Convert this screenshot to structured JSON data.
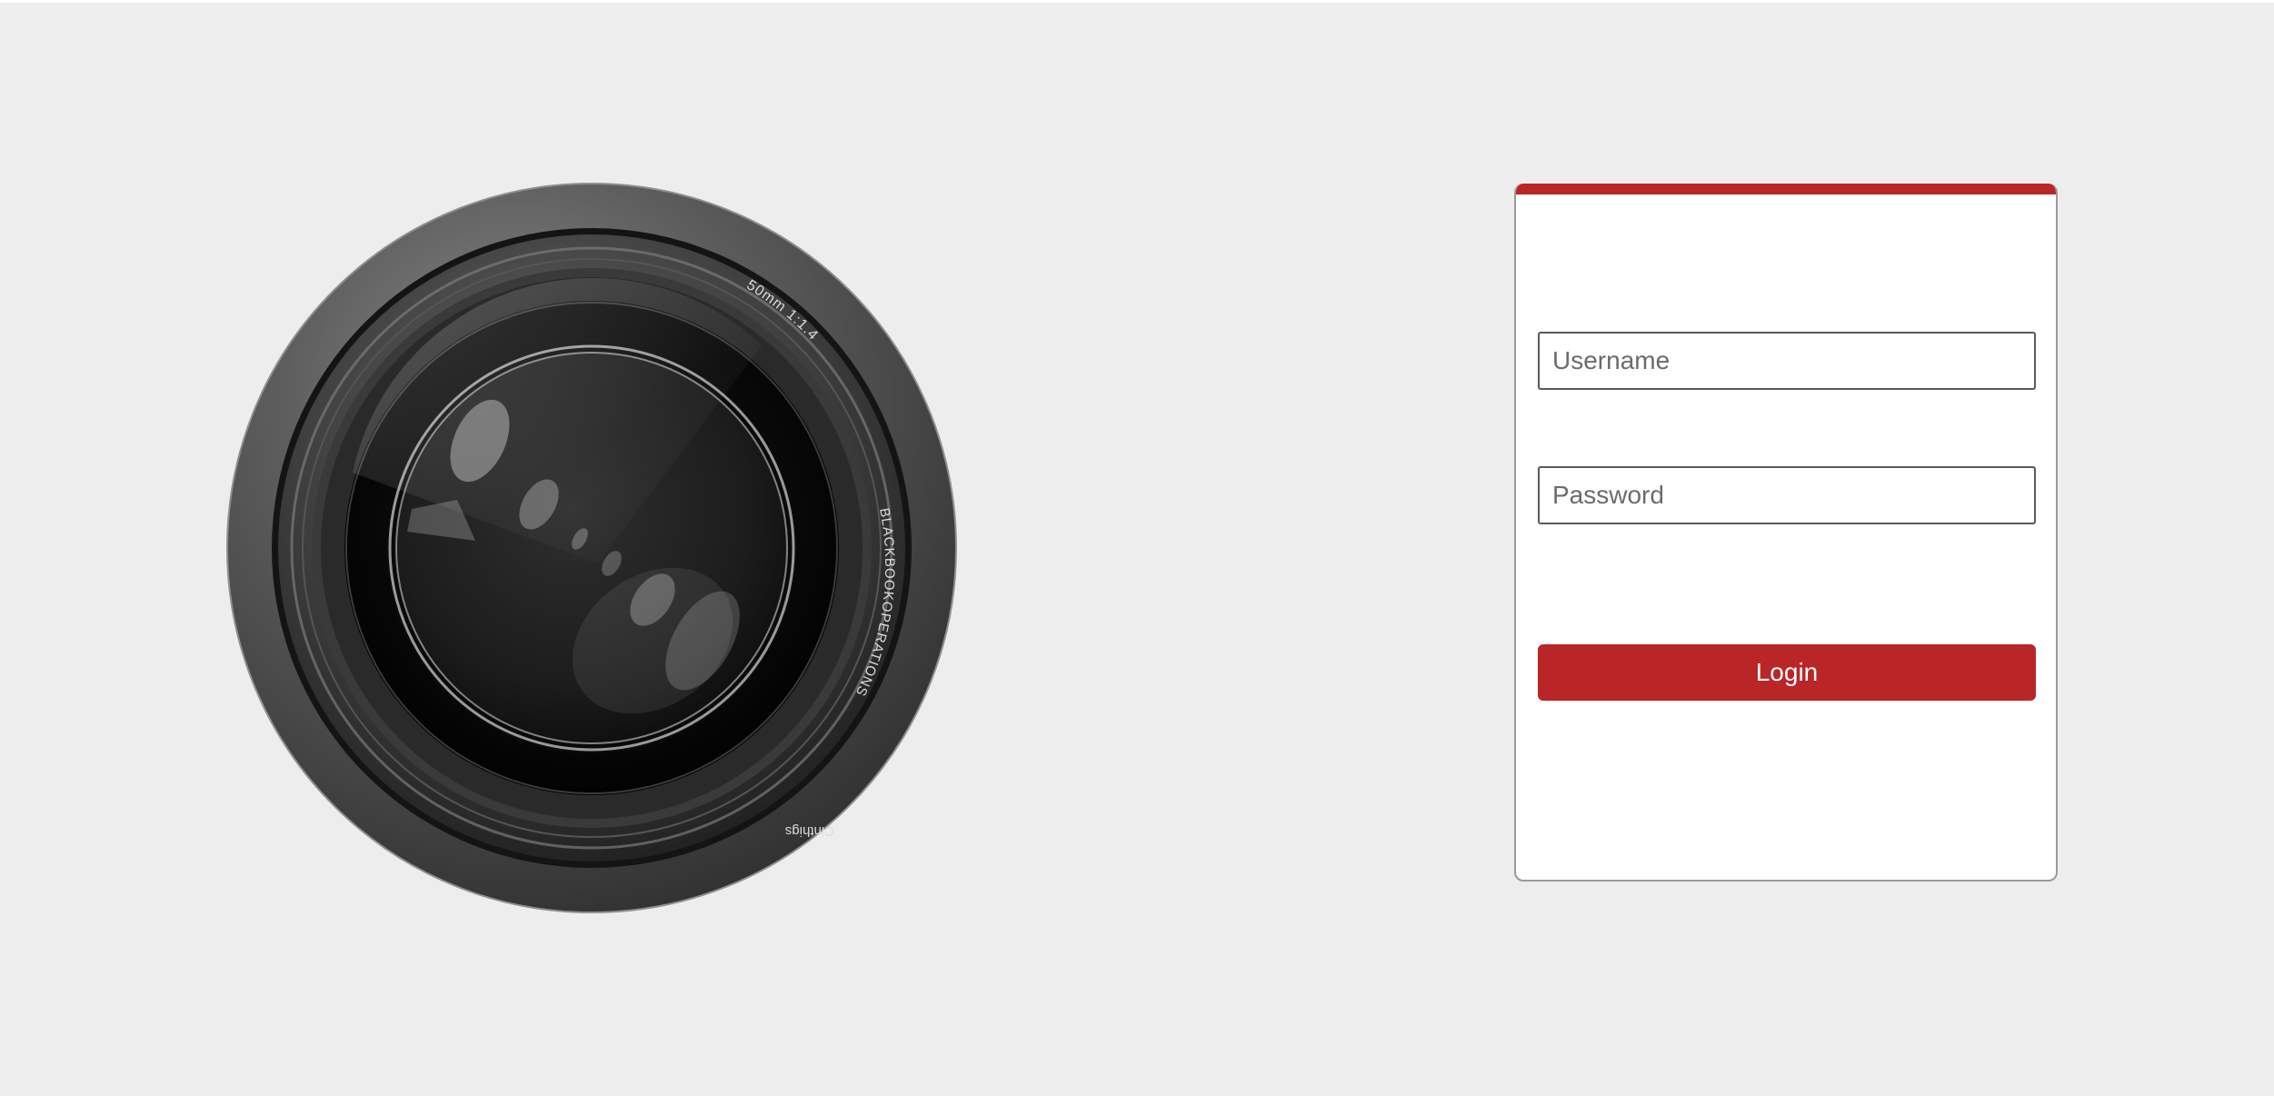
{
  "lens": {
    "spec_label": "50mm 1:1.4",
    "brand_label": "BLACKBOOKOPERATIONS",
    "maker_label": "Cinthigs"
  },
  "login": {
    "username_placeholder": "Username",
    "password_placeholder": "Password",
    "button_label": "Login"
  },
  "colors": {
    "background": "#ededed",
    "accent": "#ba2528",
    "card": "#ffffff"
  }
}
